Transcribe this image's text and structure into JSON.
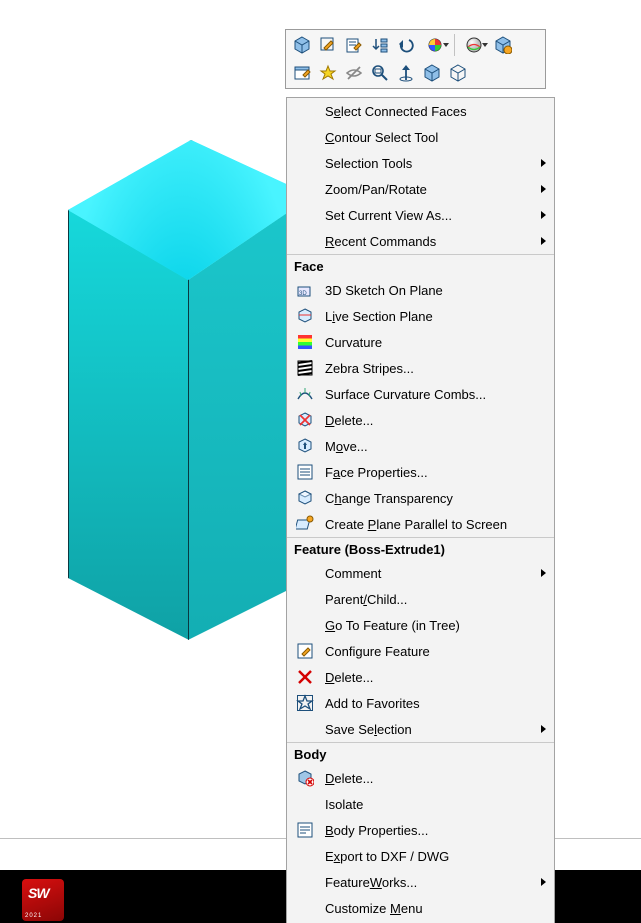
{
  "top_menu": {
    "items": [
      {
        "label_html": "S<u>e</u>lect Connected Faces"
      },
      {
        "label_html": "<u>C</u>ontour Select Tool"
      },
      {
        "label_html": "Selection Tools",
        "submenu": true
      },
      {
        "label_html": "Zoom/Pan/Rotate",
        "submenu": true
      },
      {
        "label_html": "Set Current View As...",
        "submenu": true
      },
      {
        "label_html": "<u>R</u>ecent Commands",
        "submenu": true
      }
    ]
  },
  "sections": [
    {
      "title": "Face",
      "items": [
        {
          "icon": "sketch3d",
          "label_html": "3D Sketch On Plane"
        },
        {
          "icon": "livesection",
          "label_html": "L<u>i</u>ve Section Plane"
        },
        {
          "icon": "curvature",
          "label_html": "Curvature"
        },
        {
          "icon": "zebra",
          "label_html": "Zebra Stripes..."
        },
        {
          "icon": "curvcombs",
          "label_html": "Surface Curvature Combs..."
        },
        {
          "icon": "delete",
          "label_html": "<u>D</u>elete..."
        },
        {
          "icon": "move",
          "label_html": "M<u>o</u>ve..."
        },
        {
          "icon": "faceprops",
          "label_html": "F<u>a</u>ce Properties..."
        },
        {
          "icon": "transparency",
          "label_html": "C<u>h</u>ange Transparency"
        },
        {
          "icon": "planeparallel",
          "label_html": "Create <u>P</u>lane Parallel to Screen"
        }
      ]
    },
    {
      "title": "Feature (Boss-Extrude1)",
      "items": [
        {
          "icon": "",
          "label_html": "Comment",
          "submenu": true
        },
        {
          "icon": "",
          "label_html": "Parent<u>/</u>Child..."
        },
        {
          "icon": "",
          "label_html": "<u>G</u>o To Feature (in Tree)"
        },
        {
          "icon": "configure",
          "label_html": "Configure Feature"
        },
        {
          "icon": "deleteX",
          "label_html": "<u>D</u>elete..."
        },
        {
          "icon": "favorite",
          "label_html": "Add to Favorites"
        },
        {
          "icon": "",
          "label_html": "Save Se<u>l</u>ection",
          "submenu": true
        }
      ]
    },
    {
      "title": "Body",
      "items": [
        {
          "icon": "deletebody",
          "label_html": "<u>D</u>elete..."
        },
        {
          "icon": "",
          "label_html": "Isolate"
        },
        {
          "icon": "bodyprops",
          "label_html": "<u>B</u>ody Properties..."
        },
        {
          "icon": "",
          "label_html": "E<u>x</u>port to DXF / DWG"
        },
        {
          "icon": "",
          "label_html": "Feature<u>W</u>orks...",
          "submenu": true
        },
        {
          "icon": "",
          "label_html": "Customize <u>M</u>enu"
        }
      ]
    }
  ],
  "toolbar_icons_row1": [
    "cube",
    "editsketch",
    "editfeat",
    "sort",
    "undo",
    "appearance",
    "sep",
    "sphere",
    "cubecolor"
  ],
  "toolbar_icons_row2": [
    "window",
    "spark",
    "hide",
    "zoom",
    "normal",
    "viewcube",
    "isocube"
  ],
  "app_icon": {
    "text": "SW",
    "year": "2021"
  }
}
